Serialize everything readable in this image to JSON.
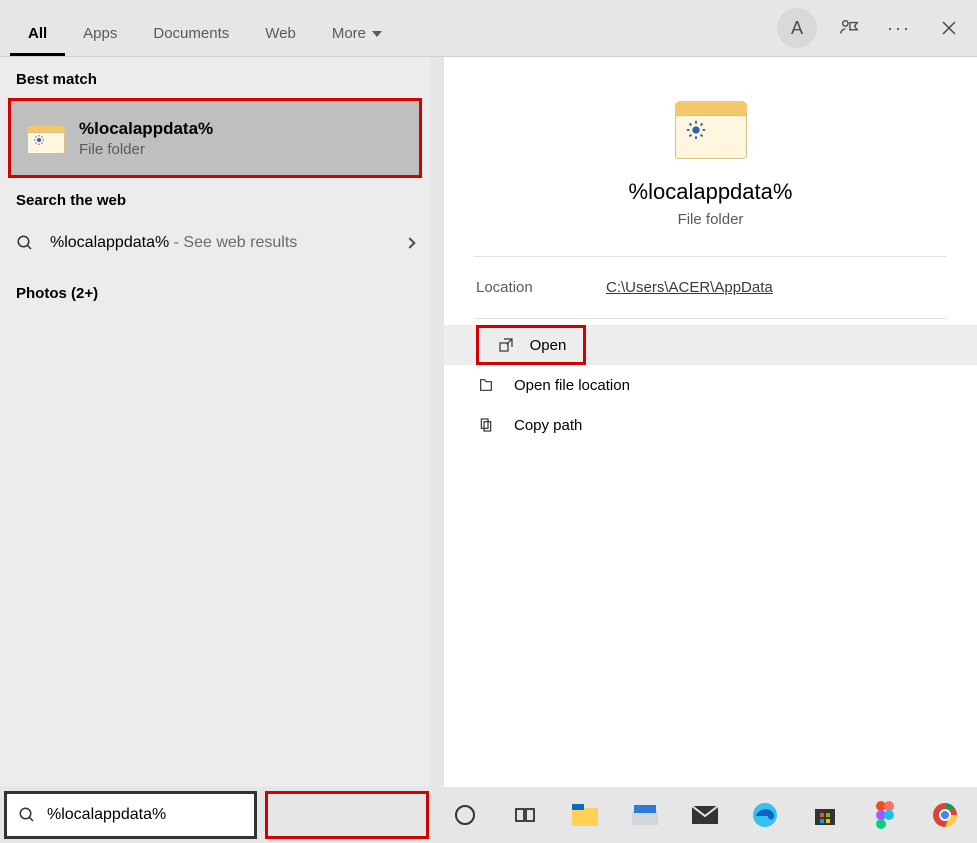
{
  "topbar": {
    "tabs": {
      "all": "All",
      "apps": "Apps",
      "documents": "Documents",
      "web": "Web",
      "more": "More"
    },
    "avatar_initial": "A"
  },
  "left": {
    "best_match_heading": "Best match",
    "best_match": {
      "title": "%localappdata%",
      "subtitle": "File folder"
    },
    "search_web_heading": "Search the web",
    "web_item": {
      "query": "%localappdata%",
      "suffix": " - See web results"
    },
    "photos_heading": "Photos (2+)"
  },
  "right": {
    "title": "%localappdata%",
    "subtitle": "File folder",
    "location_label": "Location",
    "location_path": "C:\\Users\\ACER\\AppData",
    "actions": {
      "open": "Open",
      "open_location": "Open file location",
      "copy_path": "Copy path"
    }
  },
  "search": {
    "value": "%localappdata%"
  }
}
